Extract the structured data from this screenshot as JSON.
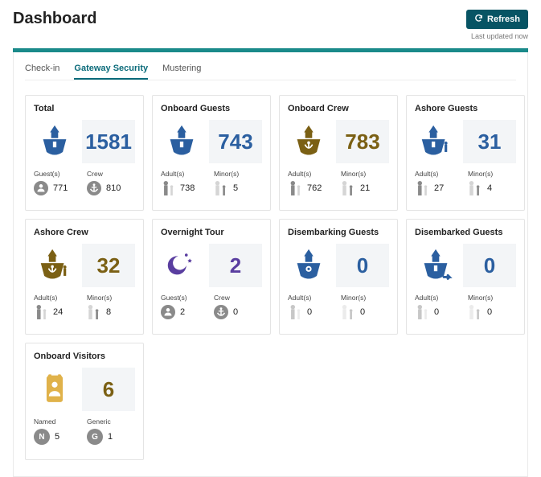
{
  "header": {
    "title": "Dashboard",
    "refresh_label": "Refresh",
    "last_updated": "Last updated now"
  },
  "tabs": [
    {
      "label": "Check-in",
      "active": false
    },
    {
      "label": "Gateway Security",
      "active": true
    },
    {
      "label": "Mustering",
      "active": false
    }
  ],
  "colors": {
    "blue": "#2b5fa0",
    "gold": "#7b6014",
    "purple": "#5a3ea0",
    "grey": "#b9b9b9",
    "teal": "#1a8a8a"
  },
  "cards": {
    "total": {
      "title": "Total",
      "total": "1581",
      "left": {
        "label": "Guest(s)",
        "value": "771"
      },
      "right": {
        "label": "Crew",
        "value": "810"
      }
    },
    "onboard_guests": {
      "title": "Onboard Guests",
      "total": "743",
      "left": {
        "label": "Adult(s)",
        "value": "738"
      },
      "right": {
        "label": "Minor(s)",
        "value": "5"
      }
    },
    "onboard_crew": {
      "title": "Onboard Crew",
      "total": "783",
      "left": {
        "label": "Adult(s)",
        "value": "762"
      },
      "right": {
        "label": "Minor(s)",
        "value": "21"
      }
    },
    "ashore_guests": {
      "title": "Ashore Guests",
      "total": "31",
      "left": {
        "label": "Adult(s)",
        "value": "27"
      },
      "right": {
        "label": "Minor(s)",
        "value": "4"
      }
    },
    "ashore_crew": {
      "title": "Ashore Crew",
      "total": "32",
      "left": {
        "label": "Adult(s)",
        "value": "24"
      },
      "right": {
        "label": "Minor(s)",
        "value": "8"
      }
    },
    "overnight_tour": {
      "title": "Overnight Tour",
      "total": "2",
      "left": {
        "label": "Guest(s)",
        "value": "2"
      },
      "right": {
        "label": "Crew",
        "value": "0"
      }
    },
    "disembarking_guests": {
      "title": "Disembarking Guests",
      "total": "0",
      "left": {
        "label": "Adult(s)",
        "value": "0"
      },
      "right": {
        "label": "Minor(s)",
        "value": "0"
      }
    },
    "disembarked_guests": {
      "title": "Disembarked Guests",
      "total": "0",
      "left": {
        "label": "Adult(s)",
        "value": "0"
      },
      "right": {
        "label": "Minor(s)",
        "value": "0"
      }
    },
    "onboard_visitors": {
      "title": "Onboard Visitors",
      "total": "6",
      "left": {
        "label": "Named",
        "value": "5",
        "letter": "N"
      },
      "right": {
        "label": "Generic",
        "value": "1",
        "letter": "G"
      }
    }
  }
}
